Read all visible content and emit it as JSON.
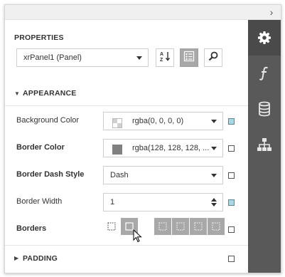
{
  "window": {
    "collapse_glyph": "›"
  },
  "properties": {
    "title": "PROPERTIES",
    "component_selector": {
      "value": "xrPanel1 (Panel)"
    },
    "toolbar": {
      "sort_alpha_icon": "sort-alphabetical-icon",
      "categorized_icon": "categorized-list-icon",
      "search_icon": "search-icon"
    }
  },
  "sidebar": {
    "tabs": [
      {
        "name": "properties-tab",
        "icon": "gear-icon",
        "active": true
      },
      {
        "name": "expressions-tab",
        "icon": "function-icon",
        "active": false
      },
      {
        "name": "data-source-tab",
        "icon": "database-icon",
        "active": false
      },
      {
        "name": "report-explorer-tab",
        "icon": "hierarchy-icon",
        "active": false
      }
    ]
  },
  "appearance": {
    "header": "APPEARANCE",
    "expanded": true,
    "rows": {
      "background_color": {
        "label": "Background Color",
        "value": "rgba(0, 0, 0, 0)",
        "swatch": "#ffffff",
        "modified": true
      },
      "border_color": {
        "label": "Border Color",
        "value": "rgba(128, 128, 128, ...",
        "swatch": "#808080",
        "modified": false
      },
      "border_dash_style": {
        "label": "Border Dash Style",
        "value": "Dash",
        "modified": false
      },
      "border_width": {
        "label": "Border Width",
        "value": "1",
        "modified": true
      },
      "borders": {
        "label": "Borders",
        "modified": false
      }
    }
  },
  "padding": {
    "header": "PADDING",
    "expanded": false
  },
  "colors": {
    "sidebar_bg": "#595959",
    "sidebar_active": "#4a4a4a",
    "pressed_button": "#a8a8a8",
    "modified_marker": "#a9d8e3"
  }
}
